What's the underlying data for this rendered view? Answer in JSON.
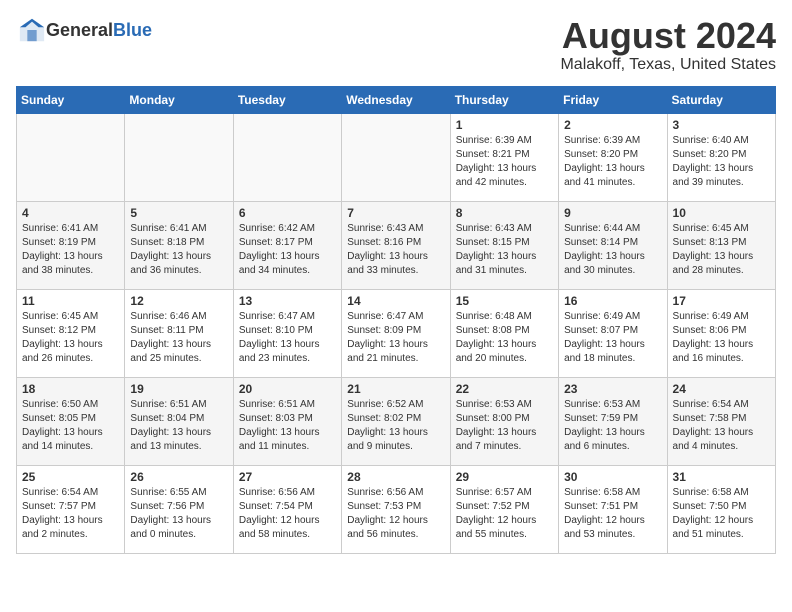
{
  "header": {
    "logo_general": "General",
    "logo_blue": "Blue",
    "month_title": "August 2024",
    "location": "Malakoff, Texas, United States"
  },
  "weekdays": [
    "Sunday",
    "Monday",
    "Tuesday",
    "Wednesday",
    "Thursday",
    "Friday",
    "Saturday"
  ],
  "weeks": [
    [
      {
        "day": "",
        "sunrise": "",
        "sunset": "",
        "daylight": ""
      },
      {
        "day": "",
        "sunrise": "",
        "sunset": "",
        "daylight": ""
      },
      {
        "day": "",
        "sunrise": "",
        "sunset": "",
        "daylight": ""
      },
      {
        "day": "",
        "sunrise": "",
        "sunset": "",
        "daylight": ""
      },
      {
        "day": "1",
        "sunrise": "Sunrise: 6:39 AM",
        "sunset": "Sunset: 8:21 PM",
        "daylight": "Daylight: 13 hours and 42 minutes."
      },
      {
        "day": "2",
        "sunrise": "Sunrise: 6:39 AM",
        "sunset": "Sunset: 8:20 PM",
        "daylight": "Daylight: 13 hours and 41 minutes."
      },
      {
        "day": "3",
        "sunrise": "Sunrise: 6:40 AM",
        "sunset": "Sunset: 8:20 PM",
        "daylight": "Daylight: 13 hours and 39 minutes."
      }
    ],
    [
      {
        "day": "4",
        "sunrise": "Sunrise: 6:41 AM",
        "sunset": "Sunset: 8:19 PM",
        "daylight": "Daylight: 13 hours and 38 minutes."
      },
      {
        "day": "5",
        "sunrise": "Sunrise: 6:41 AM",
        "sunset": "Sunset: 8:18 PM",
        "daylight": "Daylight: 13 hours and 36 minutes."
      },
      {
        "day": "6",
        "sunrise": "Sunrise: 6:42 AM",
        "sunset": "Sunset: 8:17 PM",
        "daylight": "Daylight: 13 hours and 34 minutes."
      },
      {
        "day": "7",
        "sunrise": "Sunrise: 6:43 AM",
        "sunset": "Sunset: 8:16 PM",
        "daylight": "Daylight: 13 hours and 33 minutes."
      },
      {
        "day": "8",
        "sunrise": "Sunrise: 6:43 AM",
        "sunset": "Sunset: 8:15 PM",
        "daylight": "Daylight: 13 hours and 31 minutes."
      },
      {
        "day": "9",
        "sunrise": "Sunrise: 6:44 AM",
        "sunset": "Sunset: 8:14 PM",
        "daylight": "Daylight: 13 hours and 30 minutes."
      },
      {
        "day": "10",
        "sunrise": "Sunrise: 6:45 AM",
        "sunset": "Sunset: 8:13 PM",
        "daylight": "Daylight: 13 hours and 28 minutes."
      }
    ],
    [
      {
        "day": "11",
        "sunrise": "Sunrise: 6:45 AM",
        "sunset": "Sunset: 8:12 PM",
        "daylight": "Daylight: 13 hours and 26 minutes."
      },
      {
        "day": "12",
        "sunrise": "Sunrise: 6:46 AM",
        "sunset": "Sunset: 8:11 PM",
        "daylight": "Daylight: 13 hours and 25 minutes."
      },
      {
        "day": "13",
        "sunrise": "Sunrise: 6:47 AM",
        "sunset": "Sunset: 8:10 PM",
        "daylight": "Daylight: 13 hours and 23 minutes."
      },
      {
        "day": "14",
        "sunrise": "Sunrise: 6:47 AM",
        "sunset": "Sunset: 8:09 PM",
        "daylight": "Daylight: 13 hours and 21 minutes."
      },
      {
        "day": "15",
        "sunrise": "Sunrise: 6:48 AM",
        "sunset": "Sunset: 8:08 PM",
        "daylight": "Daylight: 13 hours and 20 minutes."
      },
      {
        "day": "16",
        "sunrise": "Sunrise: 6:49 AM",
        "sunset": "Sunset: 8:07 PM",
        "daylight": "Daylight: 13 hours and 18 minutes."
      },
      {
        "day": "17",
        "sunrise": "Sunrise: 6:49 AM",
        "sunset": "Sunset: 8:06 PM",
        "daylight": "Daylight: 13 hours and 16 minutes."
      }
    ],
    [
      {
        "day": "18",
        "sunrise": "Sunrise: 6:50 AM",
        "sunset": "Sunset: 8:05 PM",
        "daylight": "Daylight: 13 hours and 14 minutes."
      },
      {
        "day": "19",
        "sunrise": "Sunrise: 6:51 AM",
        "sunset": "Sunset: 8:04 PM",
        "daylight": "Daylight: 13 hours and 13 minutes."
      },
      {
        "day": "20",
        "sunrise": "Sunrise: 6:51 AM",
        "sunset": "Sunset: 8:03 PM",
        "daylight": "Daylight: 13 hours and 11 minutes."
      },
      {
        "day": "21",
        "sunrise": "Sunrise: 6:52 AM",
        "sunset": "Sunset: 8:02 PM",
        "daylight": "Daylight: 13 hours and 9 minutes."
      },
      {
        "day": "22",
        "sunrise": "Sunrise: 6:53 AM",
        "sunset": "Sunset: 8:00 PM",
        "daylight": "Daylight: 13 hours and 7 minutes."
      },
      {
        "day": "23",
        "sunrise": "Sunrise: 6:53 AM",
        "sunset": "Sunset: 7:59 PM",
        "daylight": "Daylight: 13 hours and 6 minutes."
      },
      {
        "day": "24",
        "sunrise": "Sunrise: 6:54 AM",
        "sunset": "Sunset: 7:58 PM",
        "daylight": "Daylight: 13 hours and 4 minutes."
      }
    ],
    [
      {
        "day": "25",
        "sunrise": "Sunrise: 6:54 AM",
        "sunset": "Sunset: 7:57 PM",
        "daylight": "Daylight: 13 hours and 2 minutes."
      },
      {
        "day": "26",
        "sunrise": "Sunrise: 6:55 AM",
        "sunset": "Sunset: 7:56 PM",
        "daylight": "Daylight: 13 hours and 0 minutes."
      },
      {
        "day": "27",
        "sunrise": "Sunrise: 6:56 AM",
        "sunset": "Sunset: 7:54 PM",
        "daylight": "Daylight: 12 hours and 58 minutes."
      },
      {
        "day": "28",
        "sunrise": "Sunrise: 6:56 AM",
        "sunset": "Sunset: 7:53 PM",
        "daylight": "Daylight: 12 hours and 56 minutes."
      },
      {
        "day": "29",
        "sunrise": "Sunrise: 6:57 AM",
        "sunset": "Sunset: 7:52 PM",
        "daylight": "Daylight: 12 hours and 55 minutes."
      },
      {
        "day": "30",
        "sunrise": "Sunrise: 6:58 AM",
        "sunset": "Sunset: 7:51 PM",
        "daylight": "Daylight: 12 hours and 53 minutes."
      },
      {
        "day": "31",
        "sunrise": "Sunrise: 6:58 AM",
        "sunset": "Sunset: 7:50 PM",
        "daylight": "Daylight: 12 hours and 51 minutes."
      }
    ]
  ]
}
